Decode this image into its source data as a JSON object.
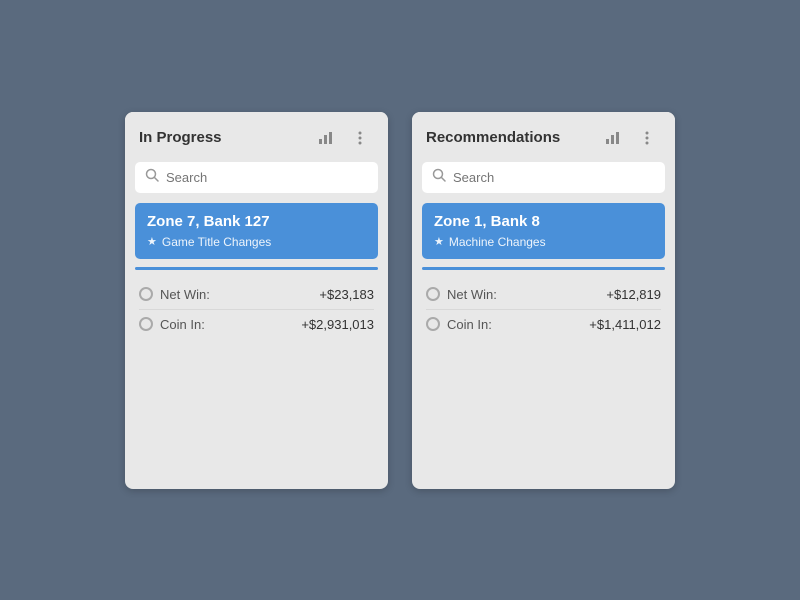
{
  "cards": [
    {
      "id": "in-progress",
      "title": "In Progress",
      "search_placeholder": "Search",
      "selected_item": {
        "title": "Zone 7, Bank 127",
        "subtitle": "Game Title Changes"
      },
      "stats": [
        {
          "label": "Net Win:",
          "value": "+$23,183"
        },
        {
          "label": "Coin In:",
          "value": "+$2,931,013"
        }
      ]
    },
    {
      "id": "recommendations",
      "title": "Recommendations",
      "search_placeholder": "Search",
      "selected_item": {
        "title": "Zone 1, Bank 8",
        "subtitle": "Machine Changes"
      },
      "stats": [
        {
          "label": "Net Win:",
          "value": "+$12,819"
        },
        {
          "label": "Coin In:",
          "value": "+$1,411,012"
        }
      ]
    }
  ]
}
